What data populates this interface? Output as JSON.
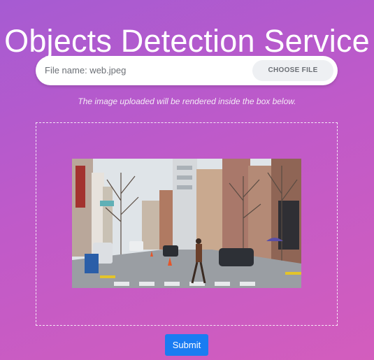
{
  "header": {
    "title": "Objects Detection Service"
  },
  "upload": {
    "file_name_text": "File name: web.jpeg",
    "choose_button_label": "CHOOSE FILE",
    "hint": "The image uploaded will be rendered inside the box below."
  },
  "preview": {
    "image_semantic": "street-scene-photo"
  },
  "actions": {
    "submit_label": "Submit"
  },
  "colors": {
    "background_start": "#a65bd2",
    "background_end": "#d35dbd",
    "submit_button": "#1a7cf2",
    "file_bar": "#ffffff"
  }
}
